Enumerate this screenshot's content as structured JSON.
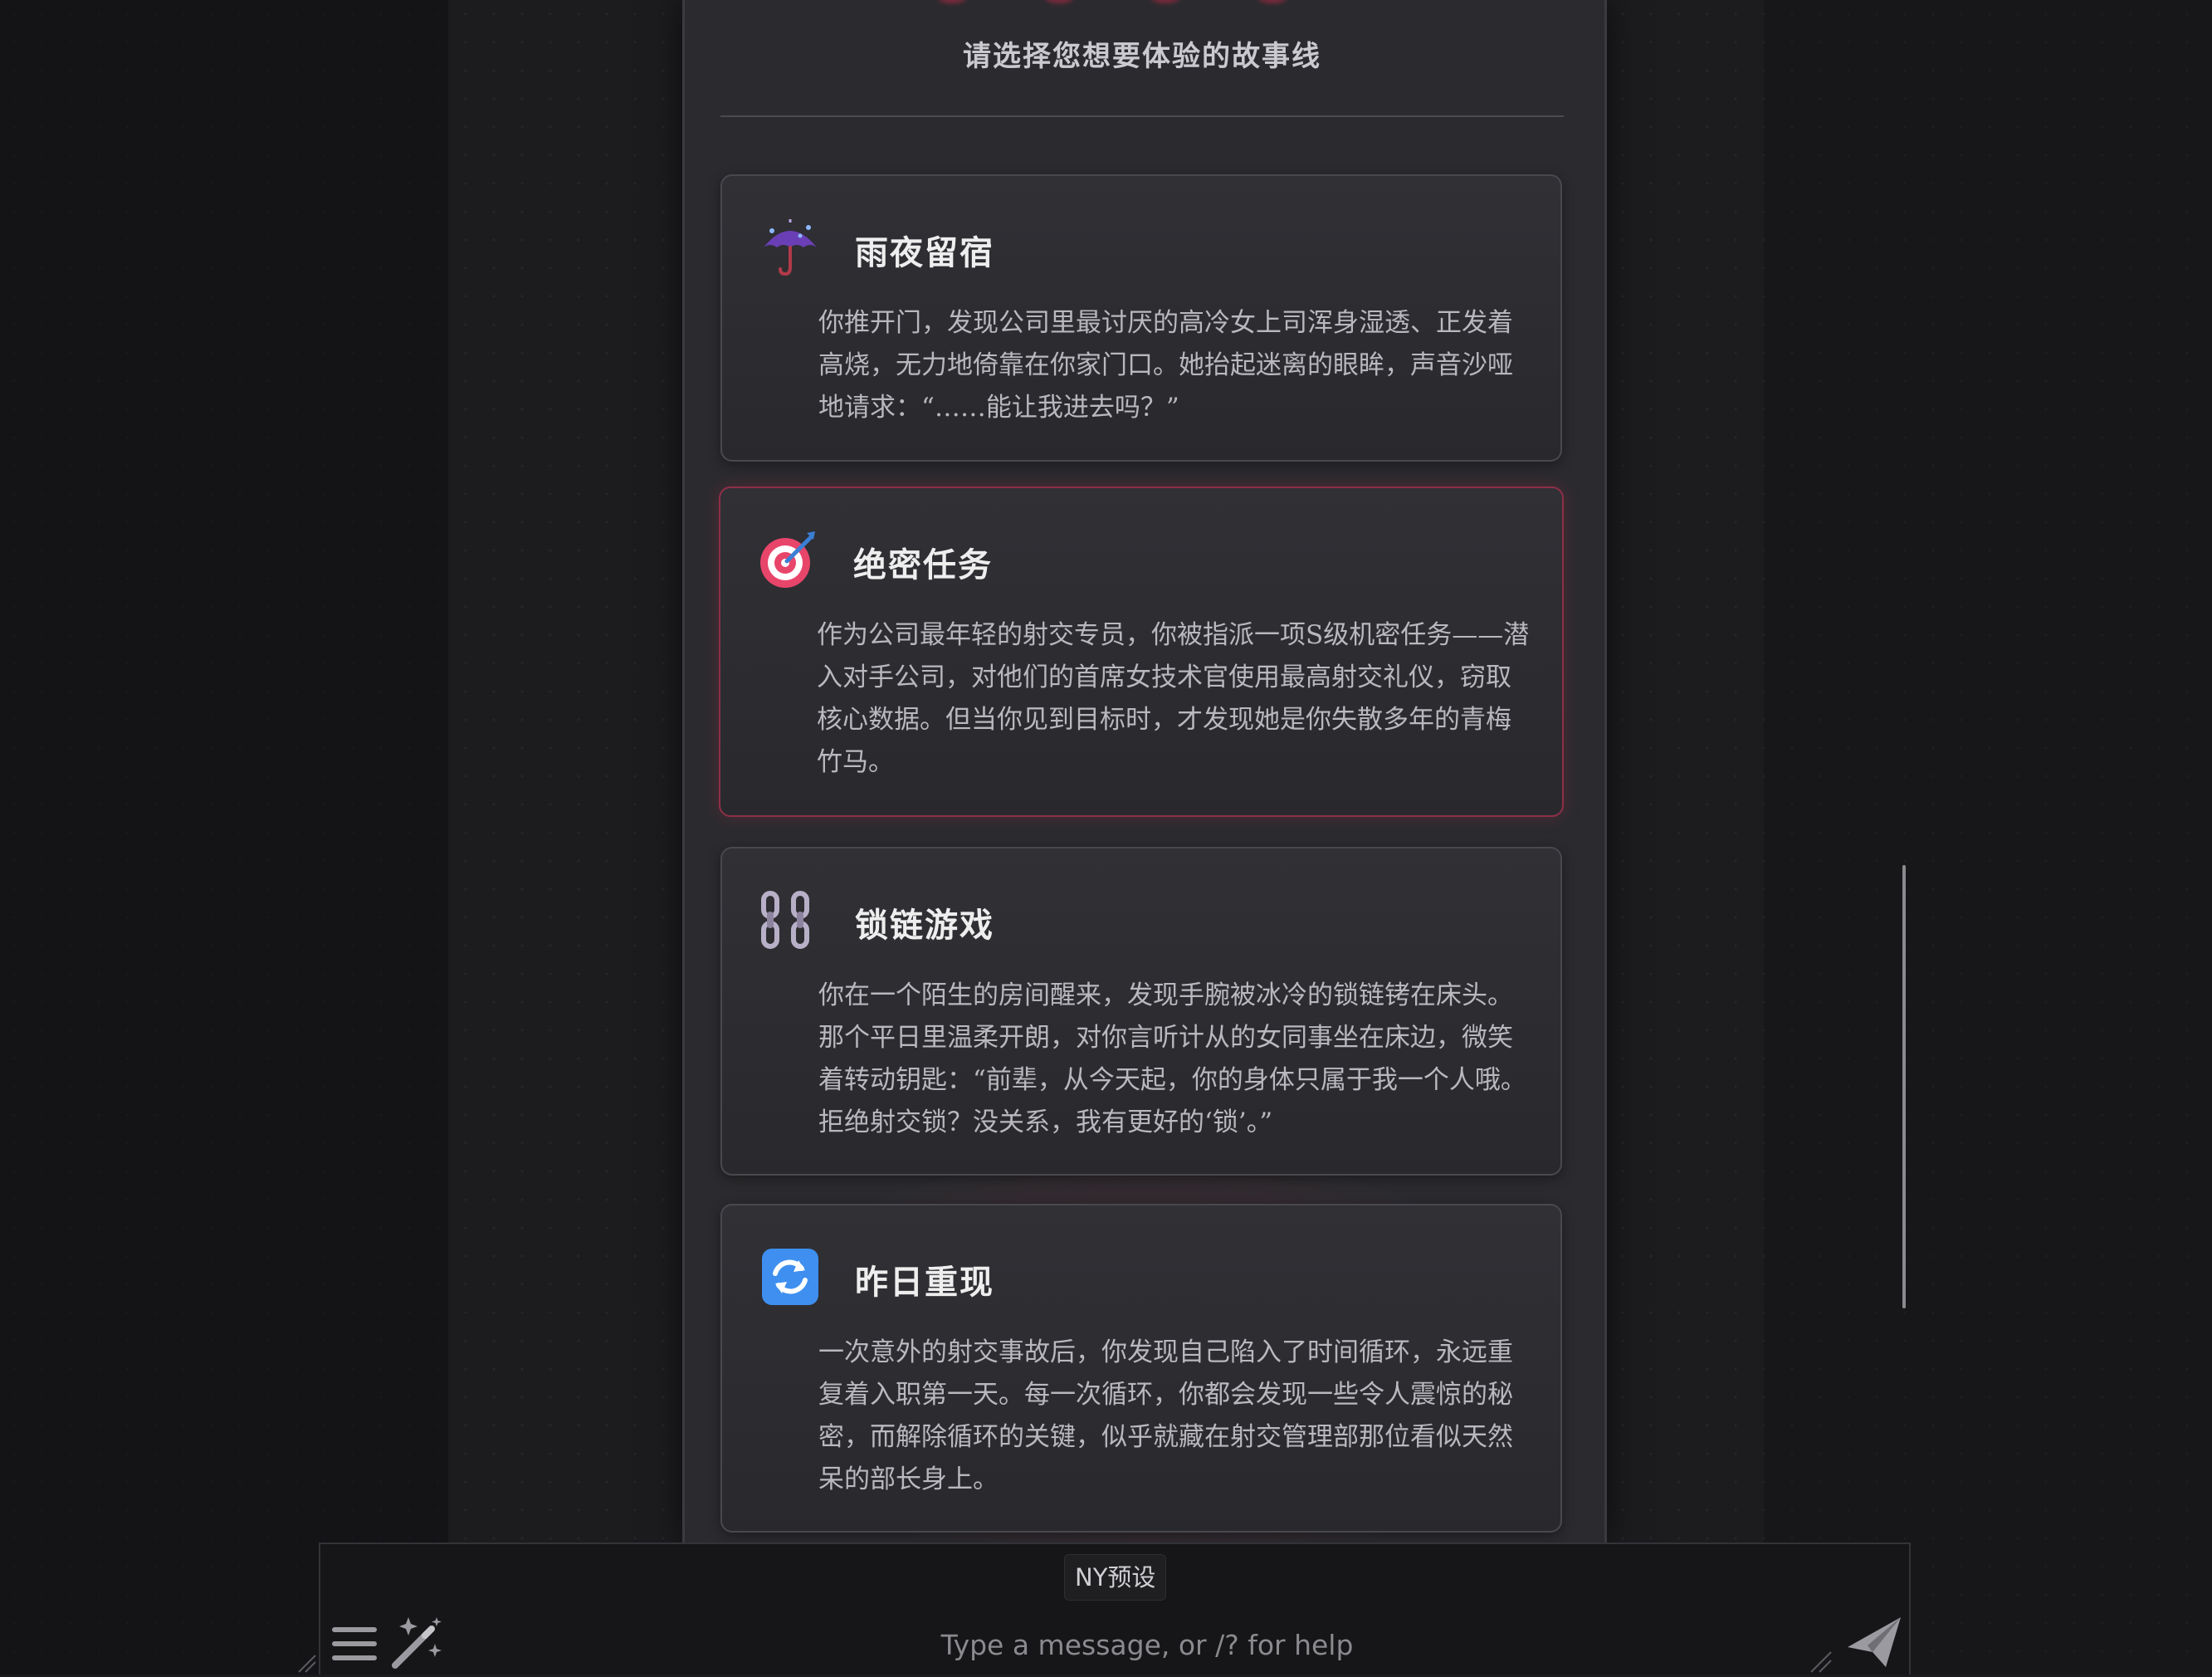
{
  "colors": {
    "accent": "#8e2f48",
    "card_bg": "#2e2e33",
    "page_bg": "#1c1c1f",
    "title_text": "#eeeeee",
    "body_text": "#b8b8be"
  },
  "story_select": {
    "heading": "请选择您想要体验的故事线",
    "cards": [
      {
        "icon": "umbrella-rain-icon",
        "title": "雨夜留宿",
        "description": "你推开门，发现公司里最讨厌的高冷女上司浑身湿透、正发着高烧，无力地倚靠在你家门口。她抬起迷离的眼眸，声音沙哑地请求：“……能让我进去吗？”"
      },
      {
        "icon": "bullseye-dart-icon",
        "title": "绝密任务",
        "description": "作为公司最年轻的射交专员，你被指派一项S级机密任务——潜入对手公司，对他们的首席女技术官使用最高射交礼仪，窃取核心数据。但当你见到目标时，才发现她是你失散多年的青梅竹马。"
      },
      {
        "icon": "chain-icon",
        "title": "锁链游戏",
        "description": "你在一个陌生的房间醒来，发现手腕被冰冷的锁链铐在床头。那个平日里温柔开朗，对你言听计从的女同事坐在床边，微笑着转动钥匙：“前辈，从今天起，你的身体只属于我一个人哦。拒绝射交锁？没关系，我有更好的‘锁’。”"
      },
      {
        "icon": "repeat-arrows-icon",
        "title": "昨日重现",
        "description": "一次意外的射交事故后，你发现自己陷入了时间循环，永远重复着入职第一天。每一次循环，你都会发现一些令人震惊的秘密，而解除循环的关键，似乎就藏在射交管理部那位看似天然呆的部长身上。"
      }
    ]
  },
  "input_bar": {
    "preset_label": "NY预设",
    "placeholder": "Type a message, or /? for help",
    "value": "",
    "menu_icon": "hamburger-menu-icon",
    "wand_icon": "magic-wand-icon",
    "send_icon": "send-icon"
  }
}
